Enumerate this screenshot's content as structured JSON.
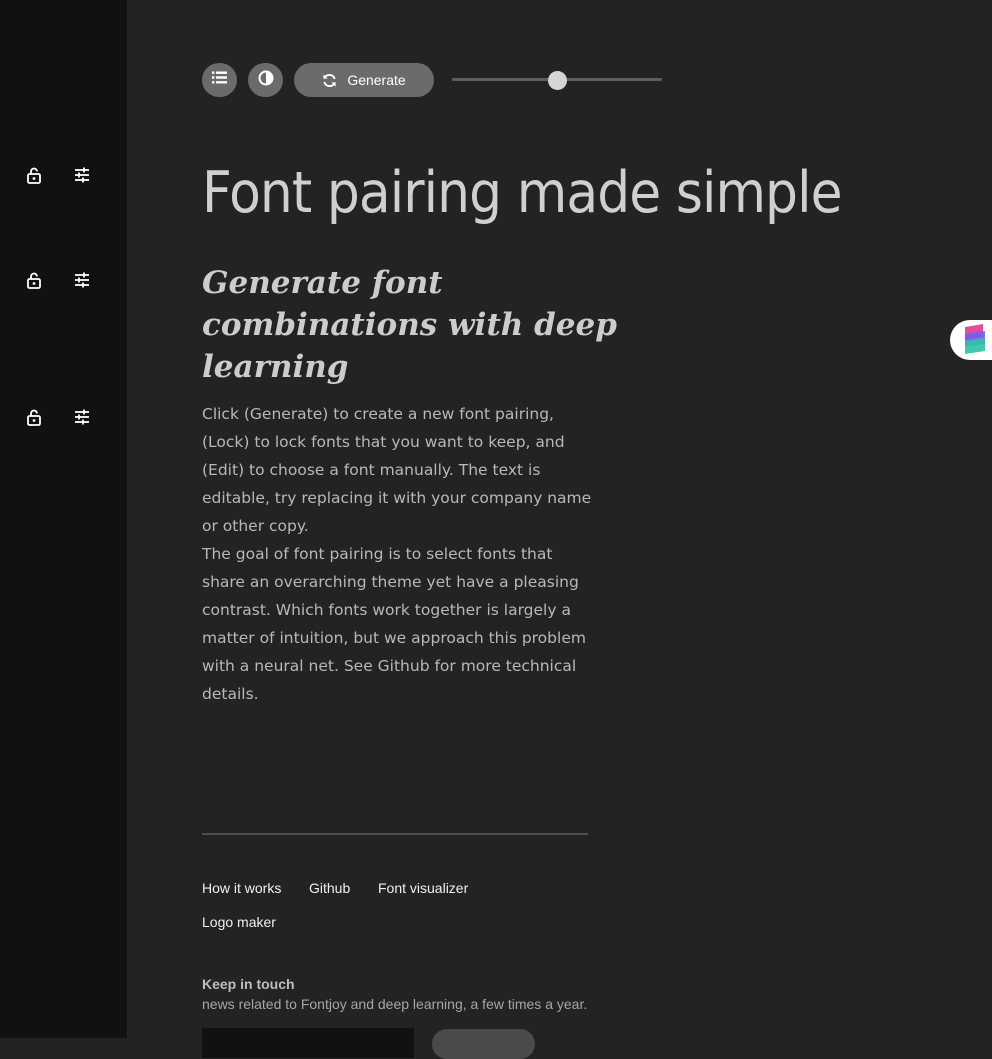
{
  "sidebar": {
    "rows": [
      {
        "lock_icon": "lock-icon",
        "tune_icon": "tune-icon"
      },
      {
        "lock_icon": "lock-icon",
        "tune_icon": "tune-icon"
      },
      {
        "lock_icon": "lock-icon",
        "tune_icon": "tune-icon"
      }
    ]
  },
  "toolbar": {
    "list_icon": "list-icon",
    "contrast_icon": "contrast-icon",
    "generate_label": "Generate",
    "generate_icon": "refresh-icon",
    "slider_value": 0.5
  },
  "heading": "Font pairing made simple",
  "subheading": "Generate font combinations with deep learning",
  "paragraphs": [
    "Click (Generate) to create a new font pairing, (Lock) to lock fonts that you want to keep, and (Edit) to choose a font manually. The text is editable, try replacing it with your company name or other copy.",
    "The goal of font pairing is to select fonts that share an overarching theme yet have a pleasing contrast. Which fonts work together is largely a matter of intuition, but we approach this problem with a neural net. See Github for more technical details."
  ],
  "footer": {
    "links": [
      "How it works",
      "Github",
      "Font visualizer",
      "Logo maker"
    ],
    "keep_in_touch_title": "Keep in touch",
    "keep_in_touch_desc": "news related to Fontjoy and deep learning, a few times a year."
  },
  "extension_tab": {
    "icon": "bookmark-logo-icon"
  },
  "colors": {
    "background": "#232323",
    "sidebar": "#111111",
    "button": "#6b6b6b",
    "text": "#b8b8b8"
  }
}
